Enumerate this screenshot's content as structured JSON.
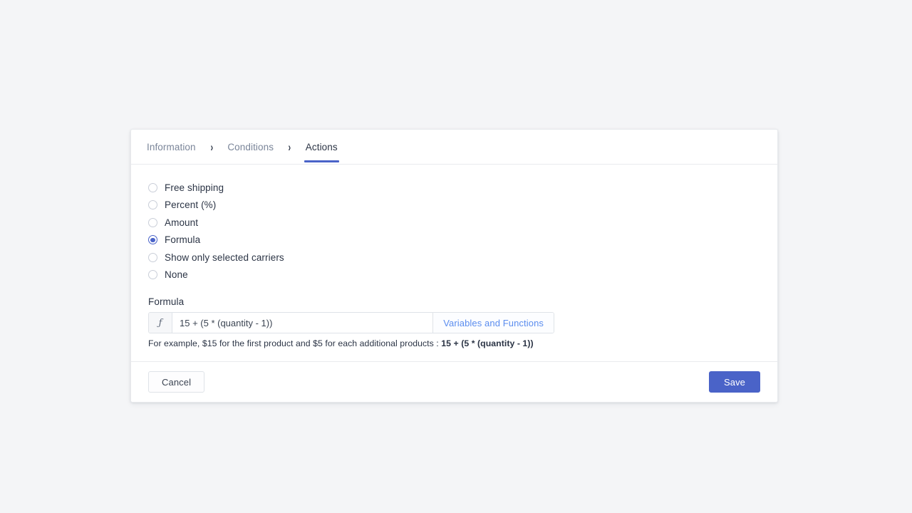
{
  "card": {
    "tabs": [
      {
        "label": "Information",
        "active": false
      },
      {
        "label": "Conditions",
        "active": false
      },
      {
        "label": "Actions",
        "active": true
      }
    ],
    "separator_icon": "chevron-right-icon",
    "separator_glyph": "›"
  },
  "actions": {
    "options": [
      {
        "label": "Free shipping",
        "selected": false
      },
      {
        "label": "Percent (%)",
        "selected": false
      },
      {
        "label": "Amount",
        "selected": false
      },
      {
        "label": "Formula",
        "selected": true
      },
      {
        "label": "Show only selected carriers",
        "selected": false
      },
      {
        "label": "None",
        "selected": false
      }
    ]
  },
  "formula": {
    "label": "Formula",
    "prefix_icon": "function-icon",
    "prefix_glyph": "ƒ",
    "value": "15 + (5 * (quantity - 1))",
    "placeholder": "",
    "variables_button_label": "Variables and Functions",
    "help_prefix": "For example, $15 for the first product and $5 for each additional products : ",
    "help_formula": "15 + (5 * (quantity - 1))"
  },
  "footer": {
    "cancel_label": "Cancel",
    "save_label": "Save"
  },
  "colors": {
    "accent": "#4a63c8",
    "link": "#5b8def",
    "page_background": "#f4f5f7",
    "text": "#2b3445",
    "muted_text": "#7a8599",
    "border": "#dfe3e8"
  }
}
